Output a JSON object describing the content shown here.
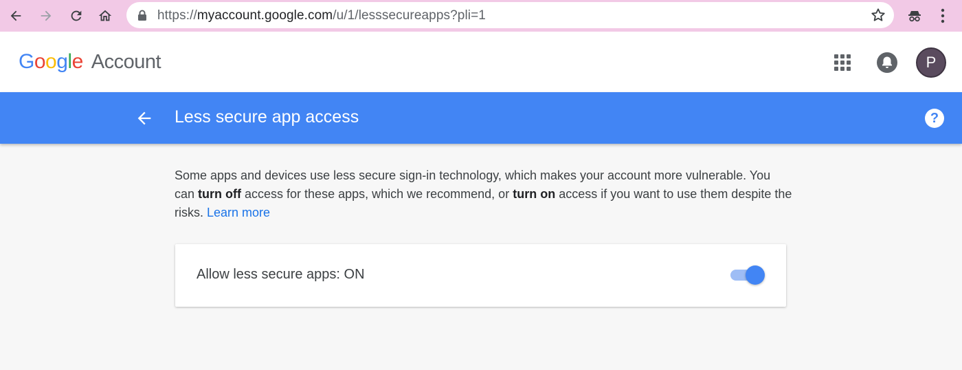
{
  "browser": {
    "url_host": "myaccount.google.com",
    "url_path": "/u/1/lesssecureapps?pli=1",
    "url_scheme": "https://"
  },
  "header": {
    "logo_letters": [
      "G",
      "o",
      "o",
      "g",
      "l",
      "e"
    ],
    "account_label": "Account",
    "avatar_initial": "P"
  },
  "titlebar": {
    "title": "Less secure app access"
  },
  "content": {
    "desc_part1": "Some apps and devices use less secure sign-in technology, which makes your account more vulnerable. You can ",
    "desc_bold1": "turn off",
    "desc_part2": " access for these apps, which we recommend, or ",
    "desc_bold2": "turn on",
    "desc_part3": " access if you want to use them despite the risks. ",
    "learn_more": "Learn more"
  },
  "setting": {
    "label": "Allow less secure apps: ON",
    "toggle_on": true
  },
  "colors": {
    "title_bar": "#4285f4",
    "chrome_bg": "#f2c9e6",
    "link": "#1a73e8"
  }
}
